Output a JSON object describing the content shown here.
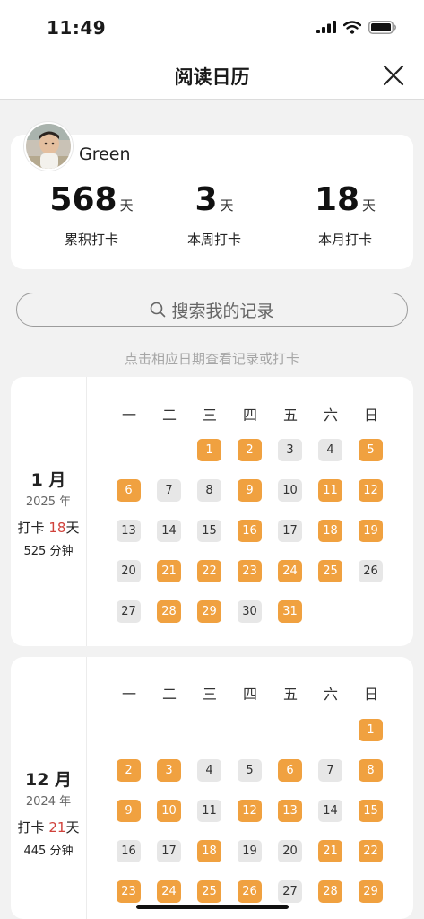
{
  "status_bar": {
    "time": "11:49"
  },
  "nav": {
    "title": "阅读日历"
  },
  "profile": {
    "name": "Green",
    "stats": [
      {
        "value": "568",
        "unit": "天",
        "label": "累积打卡"
      },
      {
        "value": "3",
        "unit": "天",
        "label": "本周打卡"
      },
      {
        "value": "18",
        "unit": "天",
        "label": "本月打卡"
      }
    ]
  },
  "search": {
    "placeholder": "搜索我的记录"
  },
  "hint": "点击相应日期查看记录或打卡",
  "weekdays": [
    "一",
    "二",
    "三",
    "四",
    "五",
    "六",
    "日"
  ],
  "months": [
    {
      "month_label": "1 月",
      "year_label": "2025 年",
      "checkin_prefix": "打卡",
      "checkin_count": "18",
      "checkin_suffix": "天",
      "minutes_label": "525 分钟",
      "first_weekday": 3,
      "days": 31,
      "checked_days": [
        1,
        2,
        5,
        6,
        9,
        11,
        12,
        16,
        18,
        19,
        21,
        22,
        23,
        24,
        25,
        28,
        29,
        31
      ]
    },
    {
      "month_label": "12 月",
      "year_label": "2024 年",
      "checkin_prefix": "打卡",
      "checkin_count": "21",
      "checkin_suffix": "天",
      "minutes_label": "445 分钟",
      "first_weekday": 7,
      "days": 29,
      "checked_days": [
        1,
        2,
        3,
        6,
        8,
        9,
        10,
        12,
        13,
        15,
        18,
        21,
        22,
        23,
        24,
        25,
        26,
        28,
        29
      ]
    }
  ],
  "colors": {
    "checked": "#f0a140",
    "unchecked": "#e7e7e7",
    "highlight": "#d0413b"
  }
}
